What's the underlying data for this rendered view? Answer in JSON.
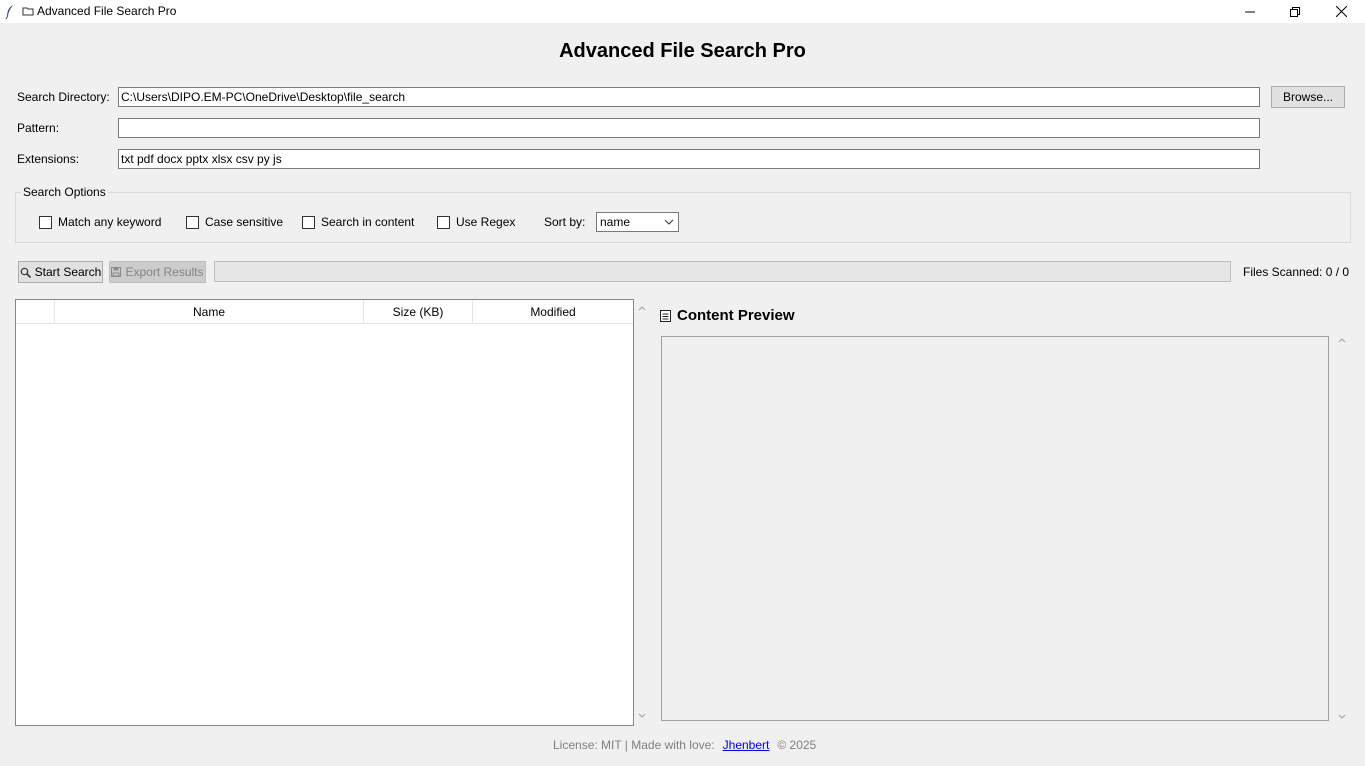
{
  "window": {
    "title": "Advanced File Search Pro"
  },
  "header": {
    "title": "Advanced File Search Pro"
  },
  "form": {
    "directory_label": "Search Directory:",
    "directory_value": "C:\\Users\\DIPO.EM-PC\\OneDrive\\Desktop\\file_search",
    "browse_label": "Browse...",
    "pattern_label": "Pattern:",
    "pattern_value": "",
    "extensions_label": "Extensions:",
    "extensions_value": "txt pdf docx pptx xlsx csv py js"
  },
  "options": {
    "group_title": "Search Options",
    "match_any_keyword": {
      "label": "Match any keyword",
      "checked": false
    },
    "case_sensitive": {
      "label": "Case sensitive",
      "checked": false
    },
    "search_in_content": {
      "label": "Search in content",
      "checked": false
    },
    "use_regex": {
      "label": "Use Regex",
      "checked": false
    },
    "sort_by_label": "Sort by:",
    "sort_by_value": "name"
  },
  "actions": {
    "start_search_label": "Start Search",
    "export_results_label": "Export Results",
    "progress_percent": 0,
    "files_scanned": "Files Scanned: 0 / 0"
  },
  "results": {
    "columns": [
      "",
      "Name",
      "Size (KB)",
      "Modified"
    ],
    "rows": []
  },
  "preview": {
    "title": "Content Preview",
    "text": ""
  },
  "footer": {
    "license_text": "License: MIT | Made with love:",
    "author_link": "Jhenbert",
    "copyright": "© 2025"
  },
  "icons": {
    "app": "feather-icon",
    "title_folder": "folder-icon",
    "start_search": "magnifier-icon",
    "export": "floppy-icon",
    "preview": "document-icon"
  },
  "colors": {
    "background": "#f0f0f0",
    "link": "#0000ee",
    "muted_text": "#7f7f7f"
  }
}
